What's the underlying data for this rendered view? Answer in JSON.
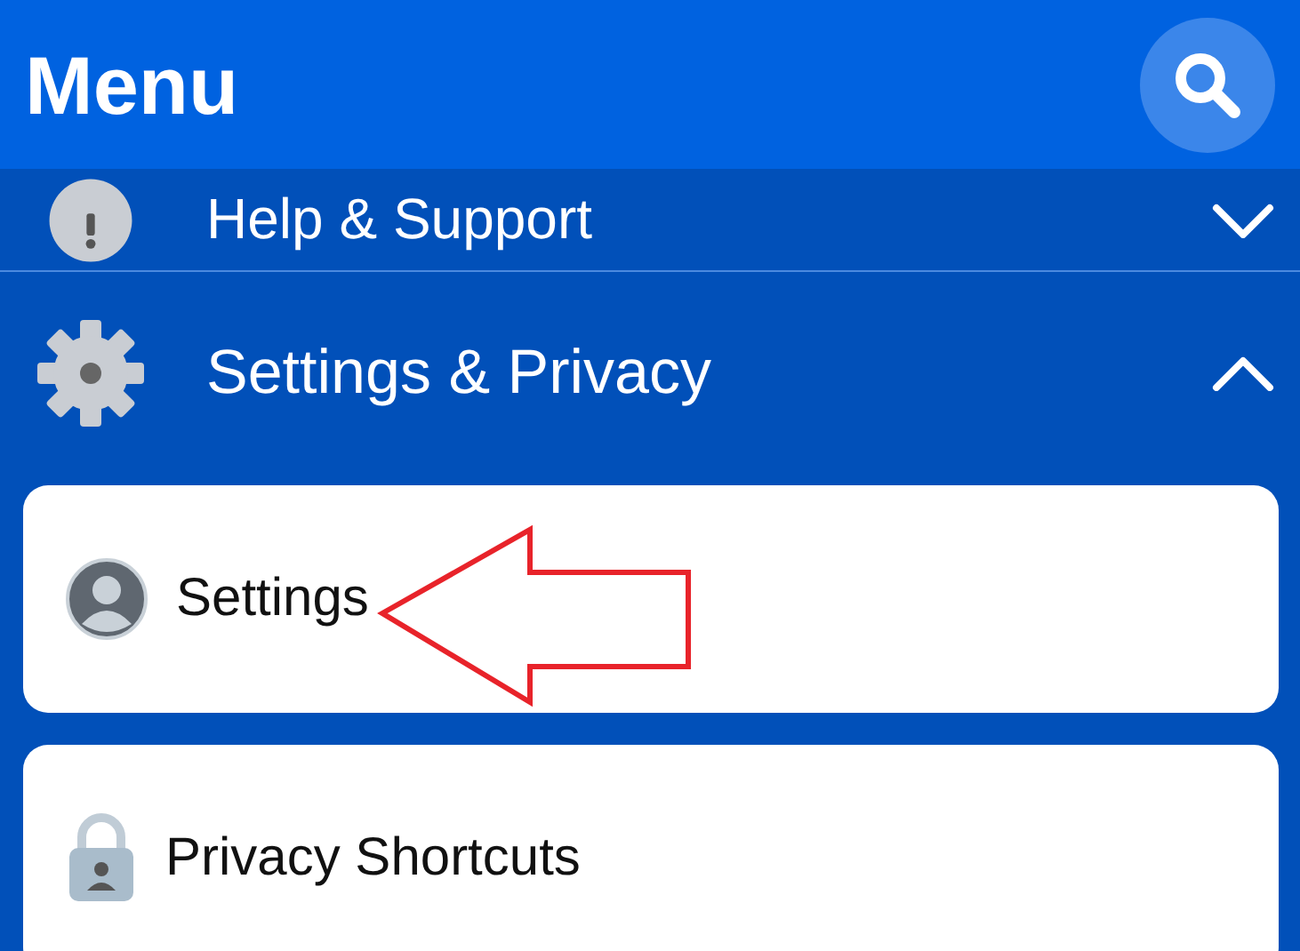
{
  "header": {
    "title": "Menu"
  },
  "sections": [
    {
      "label": "Help & Support",
      "kind": "help",
      "expanded": false
    },
    {
      "label": "Settings & Privacy",
      "kind": "gear",
      "expanded": true,
      "items": [
        {
          "label": "Settings",
          "kind": "avatar"
        },
        {
          "label": "Privacy Shortcuts",
          "kind": "lock"
        }
      ]
    }
  ]
}
